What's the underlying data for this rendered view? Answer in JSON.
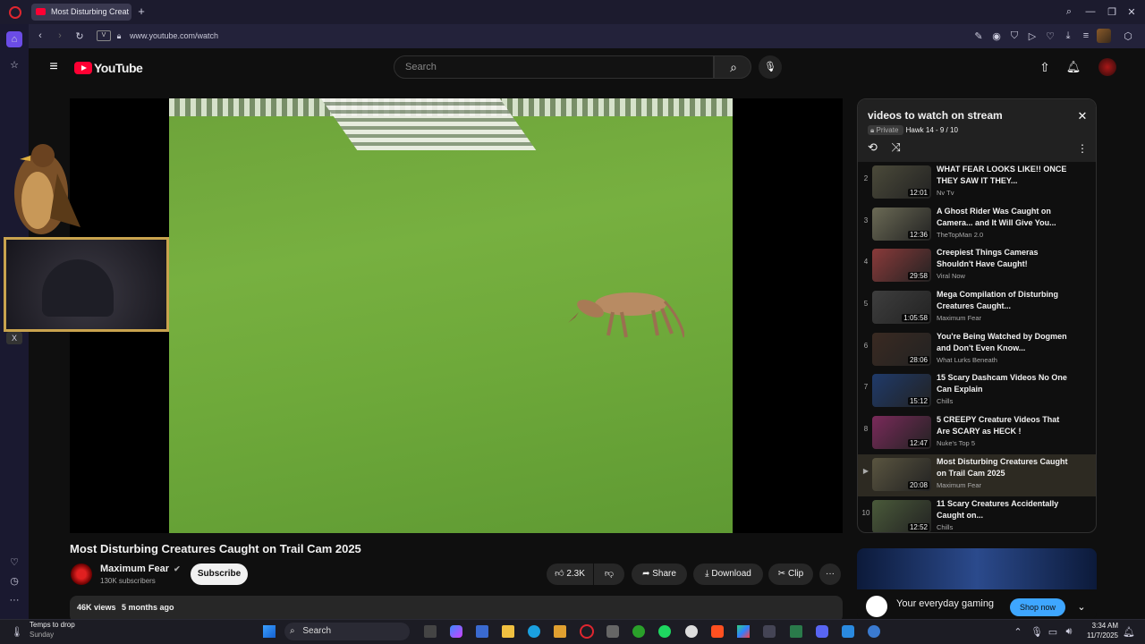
{
  "browser": {
    "tab_title": "Most Disturbing Creat",
    "url": "www.youtube.com/watch",
    "site_badge": "V"
  },
  "youtube": {
    "logo_text": "YouTube",
    "search_placeholder": "Search"
  },
  "video": {
    "title": "Most Disturbing Creatures Caught on Trail Cam 2025",
    "channel": "Maximum Fear",
    "subscribers": "130K subscribers",
    "subscribe_label": "Subscribe",
    "likes": "2.3K",
    "share_label": "Share",
    "download_label": "Download",
    "clip_label": "Clip",
    "views": "46K views",
    "age": "5 months ago"
  },
  "playlist": {
    "title": "videos to watch on stream",
    "privacy": "Private",
    "owner_progress": "Hawk 14 - 9 / 10",
    "items": [
      {
        "index": "2",
        "title": "WHAT FEAR LOOKS LIKE!! ONCE THEY SAW IT THEY...",
        "channel": "Nv Tv",
        "duration": "12:01",
        "color": "#4b4a3a"
      },
      {
        "index": "3",
        "title": "A Ghost Rider Was Caught on Camera... and It Will Give You...",
        "channel": "TheTopMan 2.0",
        "duration": "12:36",
        "color": "#6b6a55"
      },
      {
        "index": "4",
        "title": "Creepiest Things Cameras Shouldn't Have Caught!",
        "channel": "Viral Now",
        "duration": "29:58",
        "color": "#8a3a3a"
      },
      {
        "index": "5",
        "title": "Mega Compilation of Disturbing Creatures Caught...",
        "channel": "Maximum Fear",
        "duration": "1:05:58",
        "color": "#3e3e3e"
      },
      {
        "index": "6",
        "title": "You're Being Watched by Dogmen and Don't Even Know...",
        "channel": "What Lurks Beneath",
        "duration": "28:06",
        "color": "#3a2a22"
      },
      {
        "index": "7",
        "title": "15 Scary Dashcam Videos No One Can Explain",
        "channel": "Chills",
        "duration": "15:12",
        "color": "#1f3a6a"
      },
      {
        "index": "8",
        "title": "5 CREEPY Creature Videos That Are SCARY as HECK !",
        "channel": "Nuke's Top 5",
        "duration": "12:47",
        "color": "#7a2a5a"
      },
      {
        "index": "▶",
        "title": "Most Disturbing Creatures Caught on Trail Cam 2025",
        "channel": "Maximum Fear",
        "duration": "20:08",
        "color": "#5a5540"
      },
      {
        "index": "10",
        "title": "11 Scary Creatures Accidentally Caught on...",
        "channel": "Chills",
        "duration": "12:52",
        "color": "#4a5a3a"
      }
    ]
  },
  "ad": {
    "text": "Your everyday gaming",
    "button": "Shop now"
  },
  "taskbar": {
    "weather_title": "Temps to drop",
    "weather_sub": "Sunday",
    "search_label": "Search",
    "time": "3:34 AM",
    "date": "11/7/2025"
  }
}
